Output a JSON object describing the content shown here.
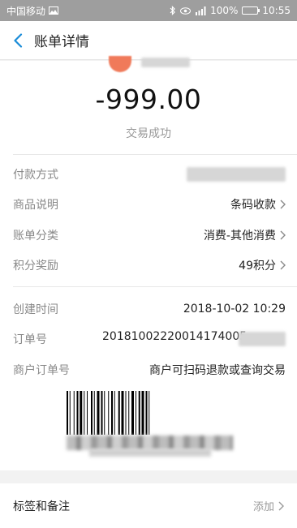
{
  "status_bar": {
    "carrier": "中国移动",
    "battery": "100%",
    "time": "10:55"
  },
  "header": {
    "title": "账单详情"
  },
  "summary": {
    "amount": "-999.00",
    "status": "交易成功"
  },
  "details": [
    {
      "label": "付款方式",
      "value": ""
    },
    {
      "label": "商品说明",
      "value": "条码收款"
    },
    {
      "label": "账单分类",
      "value": "消费-其他消费"
    },
    {
      "label": "积分奖励",
      "value": "49积分"
    }
  ],
  "meta": {
    "created_label": "创建时间",
    "created_value": "2018-10-02 10:29",
    "order_label": "订单号",
    "order_value": "20181002220014174005",
    "merchant_label": "商户订单号",
    "merchant_value": "商户可扫码退款或查询交易"
  },
  "bottom": {
    "label": "标签和备注",
    "action": "添加"
  },
  "colors": {
    "accent": "#1a8cd8",
    "status_bar": "#9e9e9e",
    "avatar": "#f07a5a"
  }
}
